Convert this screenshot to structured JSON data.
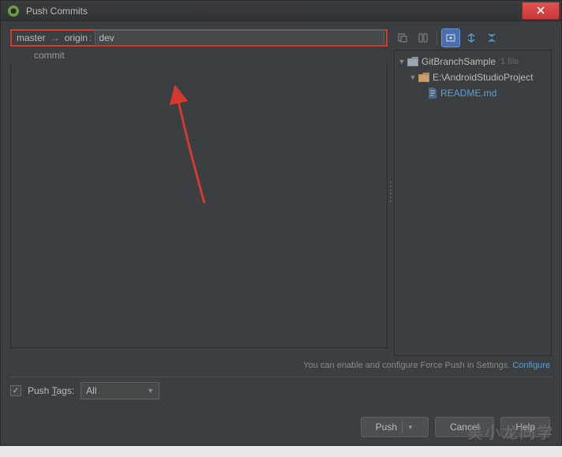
{
  "window": {
    "title": "Push Commits"
  },
  "branch": {
    "local": "master",
    "remote": "origin",
    "target": "dev"
  },
  "commits": {
    "label": "commit"
  },
  "tree": {
    "root": {
      "label": "GitBranchSample",
      "meta": "1 file"
    },
    "path": {
      "label": "E:\\AndroidStudioProject"
    },
    "file": {
      "label": "README.md"
    }
  },
  "hint": {
    "text": "You can enable and configure Force Push in Settings.",
    "link": "Configure"
  },
  "tags": {
    "label_pre": "Push ",
    "label_u": "T",
    "label_post": "ags:",
    "value": "All"
  },
  "buttons": {
    "push": "Push",
    "cancel": "Cancel",
    "help": "Help"
  },
  "watermark": "吴小龙同学"
}
